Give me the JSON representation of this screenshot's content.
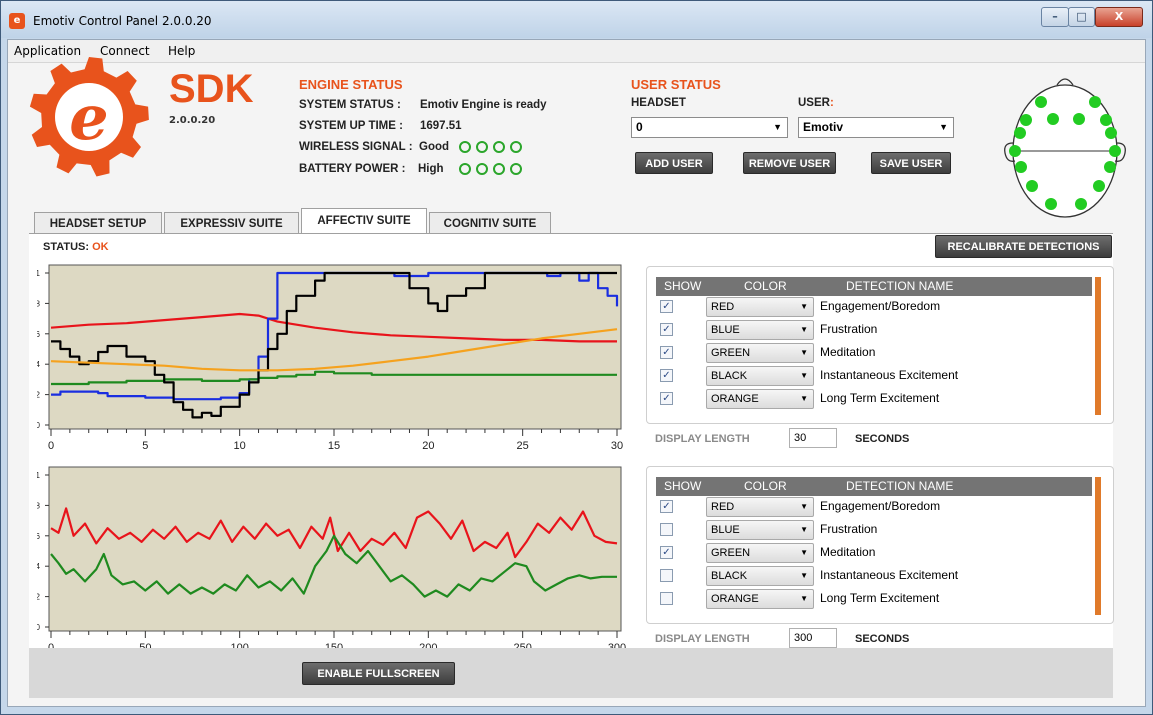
{
  "window": {
    "title": "Emotiv Control Panel 2.0.0.20",
    "min": "–",
    "max": "□",
    "close": "X"
  },
  "menu": [
    "Application",
    "Connect",
    "Help"
  ],
  "logo": {
    "letter": "e",
    "sdk": "SDK",
    "version": "2.0.0.20"
  },
  "engine": {
    "title": "ENGINE STATUS",
    "system_status_label": "SYSTEM STATUS :",
    "system_status_value": "Emotiv Engine is ready",
    "uptime_label": "SYSTEM UP TIME :",
    "uptime_value": "1697.51",
    "wireless_label": "WIRELESS SIGNAL :",
    "wireless_value": "Good",
    "battery_label": "BATTERY POWER :",
    "battery_value": "High"
  },
  "user": {
    "title": "USER STATUS",
    "headset_label": "HEADSET",
    "headset_value": "0",
    "user_label": "USER",
    "user_colon": ":",
    "user_value": "Emotiv",
    "add": "ADD USER",
    "remove": "REMOVE USER",
    "save": "SAVE USER"
  },
  "tabs": [
    "HEADSET SETUP",
    "EXPRESSIV SUITE",
    "AFFECTIV SUITE",
    "COGNITIV SUITE"
  ],
  "active_tab": 2,
  "status": {
    "label": "STATUS:",
    "value": "OK"
  },
  "recalibrate": "RECALIBRATE DETECTIONS",
  "legend_headers": {
    "show": "SHOW",
    "color": "COLOR",
    "name": "DETECTION NAME"
  },
  "legend_top": [
    {
      "checked": true,
      "color": "RED",
      "name": "Engagement/Boredom"
    },
    {
      "checked": true,
      "color": "BLUE",
      "name": "Frustration"
    },
    {
      "checked": true,
      "color": "GREEN",
      "name": "Meditation"
    },
    {
      "checked": true,
      "color": "BLACK",
      "name": "Instantaneous Excitement"
    },
    {
      "checked": true,
      "color": "ORANGE",
      "name": "Long Term Excitement"
    }
  ],
  "legend_bottom": [
    {
      "checked": true,
      "color": "RED",
      "name": "Engagement/Boredom"
    },
    {
      "checked": false,
      "color": "BLUE",
      "name": "Frustration"
    },
    {
      "checked": true,
      "color": "GREEN",
      "name": "Meditation"
    },
    {
      "checked": false,
      "color": "BLACK",
      "name": "Instantaneous Excitement"
    },
    {
      "checked": false,
      "color": "ORANGE",
      "name": "Long Term Excitement"
    }
  ],
  "display_length_label": "DISPLAY LENGTH",
  "seconds_label": "SECONDS",
  "display_length_top": "30",
  "display_length_bottom": "300",
  "fullscreen": "ENABLE FULLSCREEN",
  "colors": {
    "accent": "#e8531c",
    "red": "#e8141b",
    "blue": "#1a2ee0",
    "green": "#1f8a1f",
    "black": "#000000",
    "orange": "#f5a21e",
    "plot_bg": "#ddd9c3",
    "electrode": "#22cc22"
  },
  "chart_data": [
    {
      "type": "line",
      "xlim": [
        0,
        30
      ],
      "ylim": [
        0,
        1
      ],
      "xticks": [
        0,
        5,
        10,
        15,
        20,
        25,
        30
      ],
      "yticks": [
        "0",
        "0.2",
        "0.4",
        "0.6",
        "0.8",
        "1"
      ],
      "series": [
        {
          "name": "Engagement/Boredom",
          "color": "#e8141b",
          "step": false,
          "points": [
            [
              0,
              0.64
            ],
            [
              2,
              0.66
            ],
            [
              4,
              0.67
            ],
            [
              6,
              0.69
            ],
            [
              8,
              0.71
            ],
            [
              10,
              0.73
            ],
            [
              11,
              0.72
            ],
            [
              12,
              0.68
            ],
            [
              14,
              0.64
            ],
            [
              16,
              0.61
            ],
            [
              18,
              0.59
            ],
            [
              20,
              0.58
            ],
            [
              22,
              0.57
            ],
            [
              24,
              0.56
            ],
            [
              26,
              0.56
            ],
            [
              28,
              0.55
            ],
            [
              30,
              0.55
            ]
          ]
        },
        {
          "name": "Frustration",
          "color": "#1a2ee0",
          "step": true,
          "points": [
            [
              0,
              0.2
            ],
            [
              0.5,
              0.22
            ],
            [
              2.5,
              0.21
            ],
            [
              3,
              0.19
            ],
            [
              5,
              0.18
            ],
            [
              6.5,
              0.17
            ],
            [
              9,
              0.18
            ],
            [
              10,
              0.21
            ],
            [
              10.5,
              0.3
            ],
            [
              11,
              0.45
            ],
            [
              11.5,
              0.7
            ],
            [
              12,
              1.0
            ],
            [
              18,
              1.0
            ],
            [
              18.2,
              0.98
            ],
            [
              20,
              1.0
            ],
            [
              26,
              1.0
            ],
            [
              26.3,
              0.98
            ],
            [
              27,
              1.0
            ],
            [
              28,
              0.95
            ],
            [
              28.5,
              1.0
            ],
            [
              29,
              0.9
            ],
            [
              29.5,
              0.85
            ],
            [
              30,
              0.78
            ]
          ]
        },
        {
          "name": "Meditation",
          "color": "#1f8a1f",
          "step": true,
          "points": [
            [
              0,
              0.27
            ],
            [
              2,
              0.28
            ],
            [
              4,
              0.29
            ],
            [
              6,
              0.3
            ],
            [
              8,
              0.29
            ],
            [
              10,
              0.3
            ],
            [
              11,
              0.31
            ],
            [
              12,
              0.32
            ],
            [
              13,
              0.33
            ],
            [
              14,
              0.35
            ],
            [
              15,
              0.34
            ],
            [
              17,
              0.33
            ],
            [
              20,
              0.33
            ],
            [
              25,
              0.33
            ],
            [
              30,
              0.33
            ]
          ]
        },
        {
          "name": "Instantaneous Excitement",
          "color": "#000000",
          "step": true,
          "points": [
            [
              0,
              0.55
            ],
            [
              0.5,
              0.5
            ],
            [
              1,
              0.45
            ],
            [
              1.5,
              0.4
            ],
            [
              2,
              0.42
            ],
            [
              2.5,
              0.48
            ],
            [
              3,
              0.52
            ],
            [
              4,
              0.45
            ],
            [
              5,
              0.42
            ],
            [
              5.5,
              0.33
            ],
            [
              6,
              0.28
            ],
            [
              6.5,
              0.15
            ],
            [
              7,
              0.1
            ],
            [
              7.5,
              0.05
            ],
            [
              8,
              0.08
            ],
            [
              8.5,
              0.06
            ],
            [
              9,
              0.12
            ],
            [
              10,
              0.2
            ],
            [
              10.5,
              0.28
            ],
            [
              11,
              0.36
            ],
            [
              11.5,
              0.5
            ],
            [
              12,
              0.6
            ],
            [
              12.5,
              0.75
            ],
            [
              13,
              0.85
            ],
            [
              14,
              0.95
            ],
            [
              14.5,
              1.0
            ],
            [
              18,
              1.0
            ],
            [
              19,
              0.9
            ],
            [
              20,
              0.8
            ],
            [
              20.5,
              0.75
            ],
            [
              21,
              0.85
            ],
            [
              22,
              0.9
            ],
            [
              23,
              1.0
            ],
            [
              30,
              1.0
            ]
          ]
        },
        {
          "name": "Long Term Excitement",
          "color": "#f5a21e",
          "step": false,
          "points": [
            [
              0,
              0.42
            ],
            [
              2,
              0.41
            ],
            [
              4,
              0.4
            ],
            [
              6,
              0.39
            ],
            [
              8,
              0.37
            ],
            [
              10,
              0.36
            ],
            [
              12,
              0.36
            ],
            [
              14,
              0.37
            ],
            [
              16,
              0.39
            ],
            [
              18,
              0.42
            ],
            [
              20,
              0.45
            ],
            [
              22,
              0.49
            ],
            [
              24,
              0.53
            ],
            [
              26,
              0.57
            ],
            [
              28,
              0.6
            ],
            [
              30,
              0.63
            ]
          ]
        }
      ]
    },
    {
      "type": "line",
      "xlim": [
        0,
        300
      ],
      "ylim": [
        0,
        1
      ],
      "xticks": [
        0,
        50,
        100,
        150,
        200,
        250,
        300
      ],
      "yticks": [
        "0",
        "0.2",
        "0.4",
        "0.6",
        "0.8",
        "1"
      ],
      "series": [
        {
          "name": "Engagement/Boredom",
          "color": "#e8141b",
          "step": false,
          "points": [
            [
              0,
              0.65
            ],
            [
              4,
              0.62
            ],
            [
              8,
              0.78
            ],
            [
              12,
              0.6
            ],
            [
              18,
              0.68
            ],
            [
              24,
              0.55
            ],
            [
              30,
              0.65
            ],
            [
              36,
              0.58
            ],
            [
              42,
              0.62
            ],
            [
              48,
              0.56
            ],
            [
              54,
              0.64
            ],
            [
              60,
              0.58
            ],
            [
              66,
              0.66
            ],
            [
              72,
              0.56
            ],
            [
              78,
              0.62
            ],
            [
              84,
              0.58
            ],
            [
              90,
              0.7
            ],
            [
              96,
              0.56
            ],
            [
              102,
              0.66
            ],
            [
              108,
              0.58
            ],
            [
              114,
              0.68
            ],
            [
              120,
              0.6
            ],
            [
              126,
              0.64
            ],
            [
              132,
              0.52
            ],
            [
              138,
              0.66
            ],
            [
              144,
              0.58
            ],
            [
              148,
              0.72
            ],
            [
              152,
              0.5
            ],
            [
              158,
              0.62
            ],
            [
              164,
              0.5
            ],
            [
              170,
              0.58
            ],
            [
              176,
              0.54
            ],
            [
              182,
              0.62
            ],
            [
              188,
              0.52
            ],
            [
              194,
              0.72
            ],
            [
              200,
              0.76
            ],
            [
              206,
              0.68
            ],
            [
              212,
              0.58
            ],
            [
              218,
              0.7
            ],
            [
              224,
              0.5
            ],
            [
              230,
              0.56
            ],
            [
              236,
              0.52
            ],
            [
              242,
              0.62
            ],
            [
              246,
              0.46
            ],
            [
              252,
              0.56
            ],
            [
              258,
              0.68
            ],
            [
              264,
              0.62
            ],
            [
              270,
              0.72
            ],
            [
              276,
              0.64
            ],
            [
              282,
              0.76
            ],
            [
              288,
              0.6
            ],
            [
              294,
              0.56
            ],
            [
              300,
              0.55
            ]
          ]
        },
        {
          "name": "Meditation",
          "color": "#1f8a1f",
          "step": false,
          "points": [
            [
              0,
              0.48
            ],
            [
              4,
              0.42
            ],
            [
              8,
              0.35
            ],
            [
              12,
              0.38
            ],
            [
              18,
              0.3
            ],
            [
              24,
              0.38
            ],
            [
              28,
              0.48
            ],
            [
              32,
              0.34
            ],
            [
              38,
              0.28
            ],
            [
              44,
              0.3
            ],
            [
              50,
              0.24
            ],
            [
              56,
              0.3
            ],
            [
              62,
              0.22
            ],
            [
              68,
              0.28
            ],
            [
              74,
              0.22
            ],
            [
              80,
              0.26
            ],
            [
              86,
              0.22
            ],
            [
              92,
              0.28
            ],
            [
              98,
              0.24
            ],
            [
              104,
              0.34
            ],
            [
              110,
              0.26
            ],
            [
              116,
              0.3
            ],
            [
              122,
              0.24
            ],
            [
              128,
              0.32
            ],
            [
              134,
              0.22
            ],
            [
              140,
              0.4
            ],
            [
              146,
              0.5
            ],
            [
              150,
              0.6
            ],
            [
              156,
              0.48
            ],
            [
              162,
              0.42
            ],
            [
              168,
              0.5
            ],
            [
              174,
              0.4
            ],
            [
              180,
              0.3
            ],
            [
              186,
              0.34
            ],
            [
              192,
              0.28
            ],
            [
              198,
              0.2
            ],
            [
              204,
              0.24
            ],
            [
              210,
              0.2
            ],
            [
              216,
              0.28
            ],
            [
              222,
              0.24
            ],
            [
              228,
              0.32
            ],
            [
              234,
              0.3
            ],
            [
              240,
              0.36
            ],
            [
              246,
              0.42
            ],
            [
              252,
              0.4
            ],
            [
              256,
              0.3
            ],
            [
              262,
              0.24
            ],
            [
              268,
              0.28
            ],
            [
              274,
              0.32
            ],
            [
              280,
              0.34
            ],
            [
              286,
              0.32
            ],
            [
              292,
              0.33
            ],
            [
              300,
              0.33
            ]
          ]
        }
      ]
    }
  ]
}
